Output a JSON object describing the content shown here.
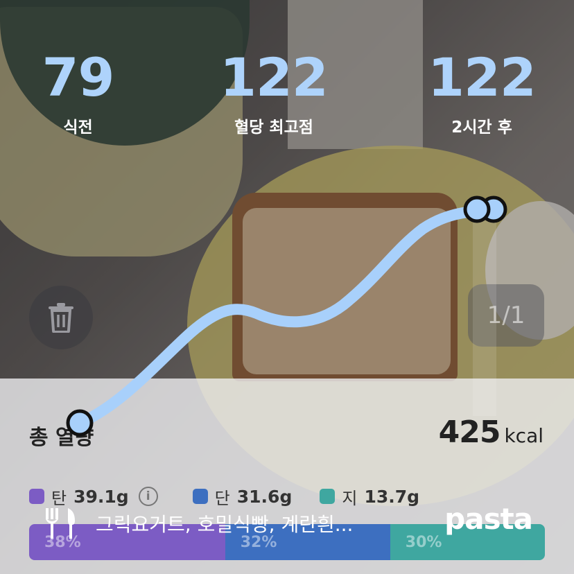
{
  "stats": [
    {
      "value": "79",
      "label": "식전"
    },
    {
      "value": "122",
      "label": "혈당 최고점"
    },
    {
      "value": "122",
      "label": "2시간 후"
    }
  ],
  "counter": "1/1",
  "total": {
    "label": "총 열량",
    "value": "425",
    "unit": "kcal"
  },
  "macros": [
    {
      "name": "탄",
      "amount": "39.1g",
      "color": "#7c5cc4"
    },
    {
      "name": "단",
      "amount": "31.6g",
      "color": "#3d6fc0"
    },
    {
      "name": "지",
      "amount": "13.7g",
      "color": "#3fa7a0"
    }
  ],
  "ratio": [
    {
      "label": "38%",
      "value": 38,
      "color": "#7c5cc4"
    },
    {
      "label": "32%",
      "value": 32,
      "color": "#3d6fc0"
    },
    {
      "label": "30%",
      "value": 30,
      "color": "#3fa7a0"
    }
  ],
  "caption": "그릭요거트, 호밀식빵, 계란흰...",
  "brand": "pasta",
  "colors": {
    "accent": "#aed3fb",
    "line": "#a8d0fb"
  },
  "icons": [
    "trash-icon",
    "fork-knife-icon",
    "info-icon"
  ]
}
